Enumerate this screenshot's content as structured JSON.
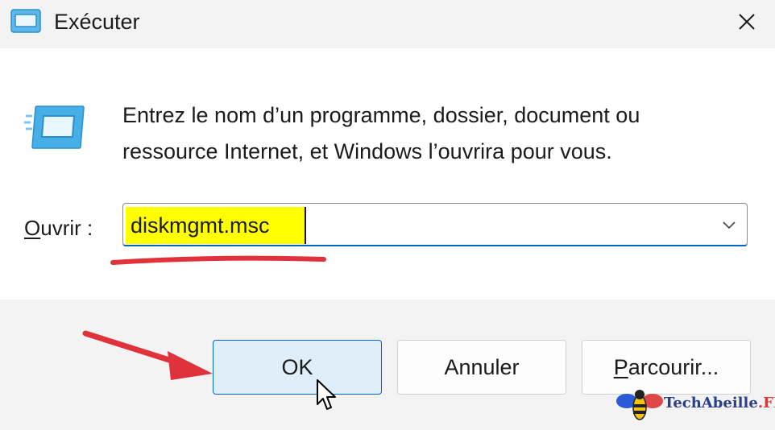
{
  "window": {
    "title": "Exécuter",
    "close_icon": "close-icon"
  },
  "content": {
    "description_line1": "Entrez le nom d’un programme, dossier, document ou",
    "description_line2": "ressource Internet, et Windows l’ouvrira pour vous.",
    "open_label_mnemonic": "O",
    "open_label_rest": "uvrir :",
    "input_value": "diskmgmt.msc",
    "highlight_color": "#ffff00",
    "annotation_color": "#e0323a"
  },
  "buttons": {
    "ok": "OK",
    "cancel": "Annuler",
    "browse_mnemonic": "P",
    "browse_rest": "arcourir..."
  },
  "watermark": {
    "brand": "TechAbeille",
    "tld": ".FR"
  }
}
